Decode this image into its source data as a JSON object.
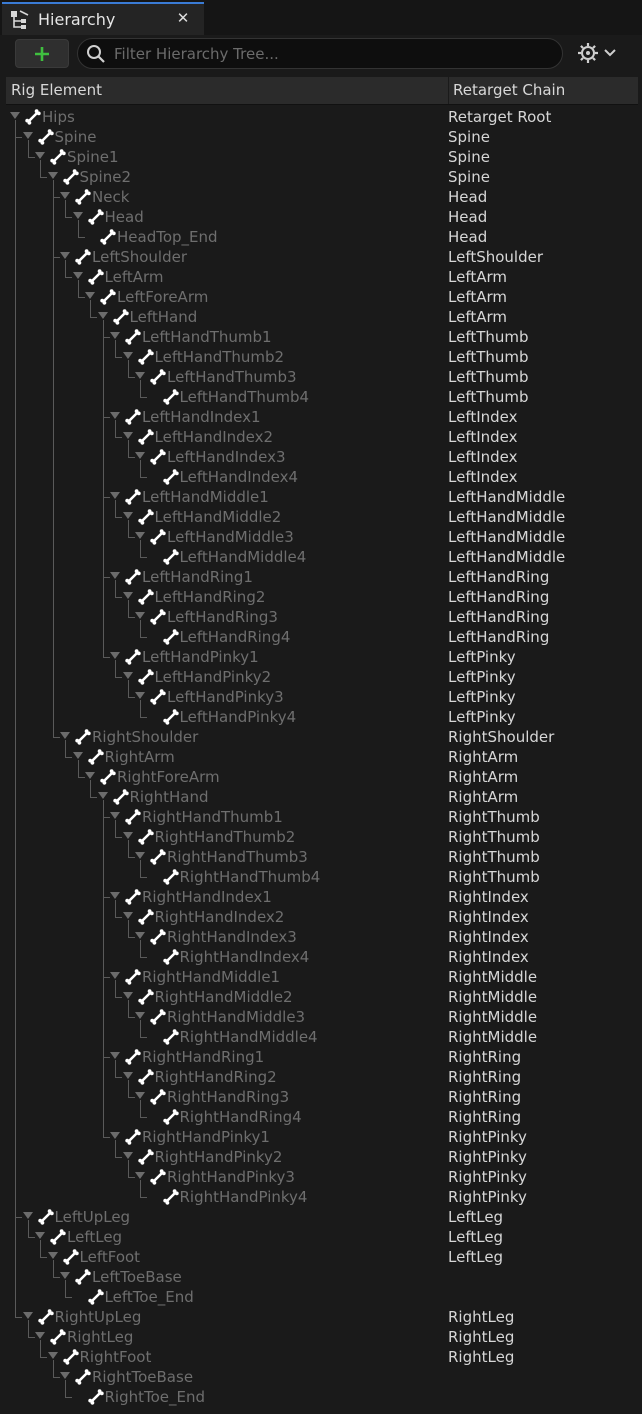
{
  "tab": {
    "title": "Hierarchy",
    "close_glyph": "✕",
    "icon": "hierarchy-icon"
  },
  "toolbar": {
    "add_glyph": "+",
    "search_placeholder": "Filter Hierarchy Tree...",
    "search_value": "",
    "settings_icon": "gear-icon",
    "accent": "#3fbf3f"
  },
  "columns": {
    "rig_element": "Rig Element",
    "retarget_chain": "Retarget Chain"
  },
  "rows": [
    {
      "name": "Hips",
      "depth": 0,
      "chain": "Retarget Root",
      "expanded": true
    },
    {
      "name": "Spine",
      "depth": 1,
      "chain": "Spine",
      "expanded": true
    },
    {
      "name": "Spine1",
      "depth": 2,
      "chain": "Spine",
      "expanded": true
    },
    {
      "name": "Spine2",
      "depth": 3,
      "chain": "Spine",
      "expanded": true
    },
    {
      "name": "Neck",
      "depth": 4,
      "chain": "Head",
      "expanded": true
    },
    {
      "name": "Head",
      "depth": 5,
      "chain": "Head",
      "expanded": true
    },
    {
      "name": "HeadTop_End",
      "depth": 6,
      "chain": "Head",
      "expanded": false
    },
    {
      "name": "LeftShoulder",
      "depth": 4,
      "chain": "LeftShoulder",
      "expanded": true
    },
    {
      "name": "LeftArm",
      "depth": 5,
      "chain": "LeftArm",
      "expanded": true
    },
    {
      "name": "LeftForeArm",
      "depth": 6,
      "chain": "LeftArm",
      "expanded": true
    },
    {
      "name": "LeftHand",
      "depth": 7,
      "chain": "LeftArm",
      "expanded": true
    },
    {
      "name": "LeftHandThumb1",
      "depth": 8,
      "chain": "LeftThumb",
      "expanded": true
    },
    {
      "name": "LeftHandThumb2",
      "depth": 9,
      "chain": "LeftThumb",
      "expanded": true
    },
    {
      "name": "LeftHandThumb3",
      "depth": 10,
      "chain": "LeftThumb",
      "expanded": true
    },
    {
      "name": "LeftHandThumb4",
      "depth": 11,
      "chain": "LeftThumb",
      "expanded": false
    },
    {
      "name": "LeftHandIndex1",
      "depth": 8,
      "chain": "LeftIndex",
      "expanded": true
    },
    {
      "name": "LeftHandIndex2",
      "depth": 9,
      "chain": "LeftIndex",
      "expanded": true
    },
    {
      "name": "LeftHandIndex3",
      "depth": 10,
      "chain": "LeftIndex",
      "expanded": true
    },
    {
      "name": "LeftHandIndex4",
      "depth": 11,
      "chain": "LeftIndex",
      "expanded": false
    },
    {
      "name": "LeftHandMiddle1",
      "depth": 8,
      "chain": "LeftHandMiddle",
      "expanded": true
    },
    {
      "name": "LeftHandMiddle2",
      "depth": 9,
      "chain": "LeftHandMiddle",
      "expanded": true
    },
    {
      "name": "LeftHandMiddle3",
      "depth": 10,
      "chain": "LeftHandMiddle",
      "expanded": true
    },
    {
      "name": "LeftHandMiddle4",
      "depth": 11,
      "chain": "LeftHandMiddle",
      "expanded": false
    },
    {
      "name": "LeftHandRing1",
      "depth": 8,
      "chain": "LeftHandRing",
      "expanded": true
    },
    {
      "name": "LeftHandRing2",
      "depth": 9,
      "chain": "LeftHandRing",
      "expanded": true
    },
    {
      "name": "LeftHandRing3",
      "depth": 10,
      "chain": "LeftHandRing",
      "expanded": true
    },
    {
      "name": "LeftHandRing4",
      "depth": 11,
      "chain": "LeftHandRing",
      "expanded": false
    },
    {
      "name": "LeftHandPinky1",
      "depth": 8,
      "chain": "LeftPinky",
      "expanded": true
    },
    {
      "name": "LeftHandPinky2",
      "depth": 9,
      "chain": "LeftPinky",
      "expanded": true
    },
    {
      "name": "LeftHandPinky3",
      "depth": 10,
      "chain": "LeftPinky",
      "expanded": true
    },
    {
      "name": "LeftHandPinky4",
      "depth": 11,
      "chain": "LeftPinky",
      "expanded": false
    },
    {
      "name": "RightShoulder",
      "depth": 4,
      "chain": "RightShoulder",
      "expanded": true
    },
    {
      "name": "RightArm",
      "depth": 5,
      "chain": "RightArm",
      "expanded": true
    },
    {
      "name": "RightForeArm",
      "depth": 6,
      "chain": "RightArm",
      "expanded": true
    },
    {
      "name": "RightHand",
      "depth": 7,
      "chain": "RightArm",
      "expanded": true
    },
    {
      "name": "RightHandThumb1",
      "depth": 8,
      "chain": "RightThumb",
      "expanded": true
    },
    {
      "name": "RightHandThumb2",
      "depth": 9,
      "chain": "RightThumb",
      "expanded": true
    },
    {
      "name": "RightHandThumb3",
      "depth": 10,
      "chain": "RightThumb",
      "expanded": true
    },
    {
      "name": "RightHandThumb4",
      "depth": 11,
      "chain": "RightThumb",
      "expanded": false
    },
    {
      "name": "RightHandIndex1",
      "depth": 8,
      "chain": "RightIndex",
      "expanded": true
    },
    {
      "name": "RightHandIndex2",
      "depth": 9,
      "chain": "RightIndex",
      "expanded": true
    },
    {
      "name": "RightHandIndex3",
      "depth": 10,
      "chain": "RightIndex",
      "expanded": true
    },
    {
      "name": "RightHandIndex4",
      "depth": 11,
      "chain": "RightIndex",
      "expanded": false
    },
    {
      "name": "RightHandMiddle1",
      "depth": 8,
      "chain": "RightMiddle",
      "expanded": true
    },
    {
      "name": "RightHandMiddle2",
      "depth": 9,
      "chain": "RightMiddle",
      "expanded": true
    },
    {
      "name": "RightHandMiddle3",
      "depth": 10,
      "chain": "RightMiddle",
      "expanded": true
    },
    {
      "name": "RightHandMiddle4",
      "depth": 11,
      "chain": "RightMiddle",
      "expanded": false
    },
    {
      "name": "RightHandRing1",
      "depth": 8,
      "chain": "RightRing",
      "expanded": true
    },
    {
      "name": "RightHandRing2",
      "depth": 9,
      "chain": "RightRing",
      "expanded": true
    },
    {
      "name": "RightHandRing3",
      "depth": 10,
      "chain": "RightRing",
      "expanded": true
    },
    {
      "name": "RightHandRing4",
      "depth": 11,
      "chain": "RightRing",
      "expanded": false
    },
    {
      "name": "RightHandPinky1",
      "depth": 8,
      "chain": "RightPinky",
      "expanded": true
    },
    {
      "name": "RightHandPinky2",
      "depth": 9,
      "chain": "RightPinky",
      "expanded": true
    },
    {
      "name": "RightHandPinky3",
      "depth": 10,
      "chain": "RightPinky",
      "expanded": true
    },
    {
      "name": "RightHandPinky4",
      "depth": 11,
      "chain": "RightPinky",
      "expanded": false
    },
    {
      "name": "LeftUpLeg",
      "depth": 1,
      "chain": "LeftLeg",
      "expanded": true
    },
    {
      "name": "LeftLeg",
      "depth": 2,
      "chain": "LeftLeg",
      "expanded": true
    },
    {
      "name": "LeftFoot",
      "depth": 3,
      "chain": "LeftLeg",
      "expanded": true
    },
    {
      "name": "LeftToeBase",
      "depth": 4,
      "chain": "",
      "expanded": true
    },
    {
      "name": "LeftToe_End",
      "depth": 5,
      "chain": "",
      "expanded": false
    },
    {
      "name": "RightUpLeg",
      "depth": 1,
      "chain": "RightLeg",
      "expanded": true
    },
    {
      "name": "RightLeg",
      "depth": 2,
      "chain": "RightLeg",
      "expanded": true
    },
    {
      "name": "RightFoot",
      "depth": 3,
      "chain": "RightLeg",
      "expanded": true
    },
    {
      "name": "RightToeBase",
      "depth": 4,
      "chain": "",
      "expanded": true
    },
    {
      "name": "RightToe_End",
      "depth": 5,
      "chain": "",
      "expanded": false
    }
  ]
}
